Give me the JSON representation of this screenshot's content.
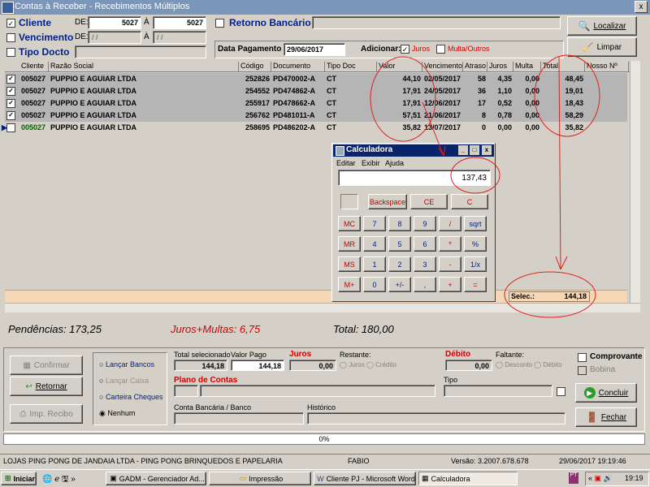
{
  "window": {
    "title": "Contas à Receber - Recebimentos Múltiplos",
    "close": "x"
  },
  "filters": {
    "cliente": {
      "label": "Cliente",
      "checked": true,
      "de_label": "DE:",
      "de": "5027",
      "a_label": "À",
      "a": "5027"
    },
    "vencimento": {
      "label": "Vencimento",
      "checked": false,
      "de_label": "DE:",
      "de": "/ /",
      "a_label": "À",
      "a": "/ /"
    },
    "tipo_docto": {
      "label": "Tipo Docto",
      "checked": false
    },
    "retorno": {
      "label": "Retorno Bancário",
      "checked": false
    },
    "data_pagamento_label": "Data Pagamento",
    "data_pagamento": "29/06/2017",
    "adicionar_label": "Adicionar:",
    "juros_label": "Juros",
    "juros_checked": true,
    "multa_label": "Multa/Outros",
    "multa_checked": false
  },
  "buttons": {
    "localizar": "Localizar",
    "limpar": "Limpar"
  },
  "grid": {
    "columns": [
      "Cliente",
      "Razão Social",
      "Código",
      "Documento",
      "Tipo Doc",
      "Valor",
      "Vencimento",
      "Atraso",
      "Juros",
      "Multa",
      "Total",
      "Nosso Nº"
    ],
    "rows": [
      {
        "cliente": "005027",
        "razao": "PUPPIO E AGUIAR LTDA",
        "codigo": "252826",
        "documento": "PD470002-A",
        "tipo": "CT",
        "valor": "44,10",
        "venc": "02/05/2017",
        "atraso": "58",
        "juros": "4,35",
        "multa": "0,00",
        "total": "48,45",
        "checked": true
      },
      {
        "cliente": "005027",
        "razao": "PUPPIO E AGUIAR LTDA",
        "codigo": "254552",
        "documento": "PD474862-A",
        "tipo": "CT",
        "valor": "17,91",
        "venc": "24/05/2017",
        "atraso": "36",
        "juros": "1,10",
        "multa": "0,00",
        "total": "19,01",
        "checked": true
      },
      {
        "cliente": "005027",
        "razao": "PUPPIO E AGUIAR LTDA",
        "codigo": "255917",
        "documento": "PD478662-A",
        "tipo": "CT",
        "valor": "17,91",
        "venc": "12/06/2017",
        "atraso": "17",
        "juros": "0,52",
        "multa": "0,00",
        "total": "18,43",
        "checked": true
      },
      {
        "cliente": "005027",
        "razao": "PUPPIO E AGUIAR LTDA",
        "codigo": "256762",
        "documento": "PD481011-A",
        "tipo": "CT",
        "valor": "57,51",
        "venc": "21/06/2017",
        "atraso": "8",
        "juros": "0,78",
        "multa": "0,00",
        "total": "58,29",
        "checked": true
      },
      {
        "cliente": "005027",
        "razao": "PUPPIO E AGUIAR LTDA",
        "codigo": "258695",
        "documento": "PD486202-A",
        "tipo": "CT",
        "valor": "35,82",
        "venc": "13/07/2017",
        "atraso": "0",
        "juros": "0,00",
        "multa": "0,00",
        "total": "35,82",
        "checked": false
      }
    ],
    "selec_label": "Selec.:",
    "selec_value": "144,18"
  },
  "totals": {
    "pendencias": "Pendências: 173,25",
    "juros_multas": "Juros+Multas: 6,75",
    "total": "Total: 180,00"
  },
  "actions": {
    "confirmar": "Confirmar",
    "retornar": "Retornar",
    "imp_recibo": "Imp. Recibo"
  },
  "payment_type": {
    "options": [
      "Lançar Bancos",
      "Lançar Caixa",
      "Carteira Cheques",
      "Nenhum"
    ],
    "selected": "Nenhum"
  },
  "payment": {
    "total_sel_label": "Total selecionado",
    "total_sel": "144,18",
    "valor_pago_label": "Valor Pago",
    "valor_pago": "144,18",
    "juros_label": "Juros",
    "juros": "0,00",
    "restante_label": "Restante:",
    "restante_juros": "Juros",
    "restante_credito": "Crédito",
    "debito_label": "Débito",
    "debito": "0,00",
    "faltante_label": "Faltante:",
    "faltante_desconto": "Desconto",
    "faltante_debito": "Débito",
    "plano_label": "Plano de Contas",
    "tipo_label": "Tipo",
    "conta_label": "Conta Bancária / Banco",
    "historico_label": "Histórico",
    "comprovante": "Comprovante",
    "bobina": "Bobina",
    "concluir": "Concluir",
    "fechar": "Fechar"
  },
  "progress": {
    "text": "0%",
    "value": 0
  },
  "status": {
    "company": "LOJAS PING PONG DE JANDAIA LTDA - PING PONG BRINQUEDOS E PAPELARIA",
    "user": "FABIO",
    "version": "Versão: 3.2007.678.678",
    "datetime": "29/06/2017 19:19:46"
  },
  "calculator": {
    "title": "Calculadora",
    "menu": [
      "Editar",
      "Exibir",
      "Ajuda"
    ],
    "display": "137,43",
    "backspace": "Backspace",
    "ce": "CE",
    "c": "C",
    "rows": [
      [
        "MC",
        "7",
        "8",
        "9",
        "/",
        "sqrt"
      ],
      [
        "MR",
        "4",
        "5",
        "6",
        "*",
        "%"
      ],
      [
        "MS",
        "1",
        "2",
        "3",
        "-",
        "1/x"
      ],
      [
        "M+",
        "0",
        "+/-",
        ",",
        "+",
        "="
      ]
    ]
  },
  "taskbar": {
    "start": "Iniciar",
    "tasks": [
      "GADM - Gerenciador Ad...",
      "Impressão",
      "Cliente PJ - Microsoft Word",
      "Calculadora"
    ],
    "clock": "19:19"
  }
}
